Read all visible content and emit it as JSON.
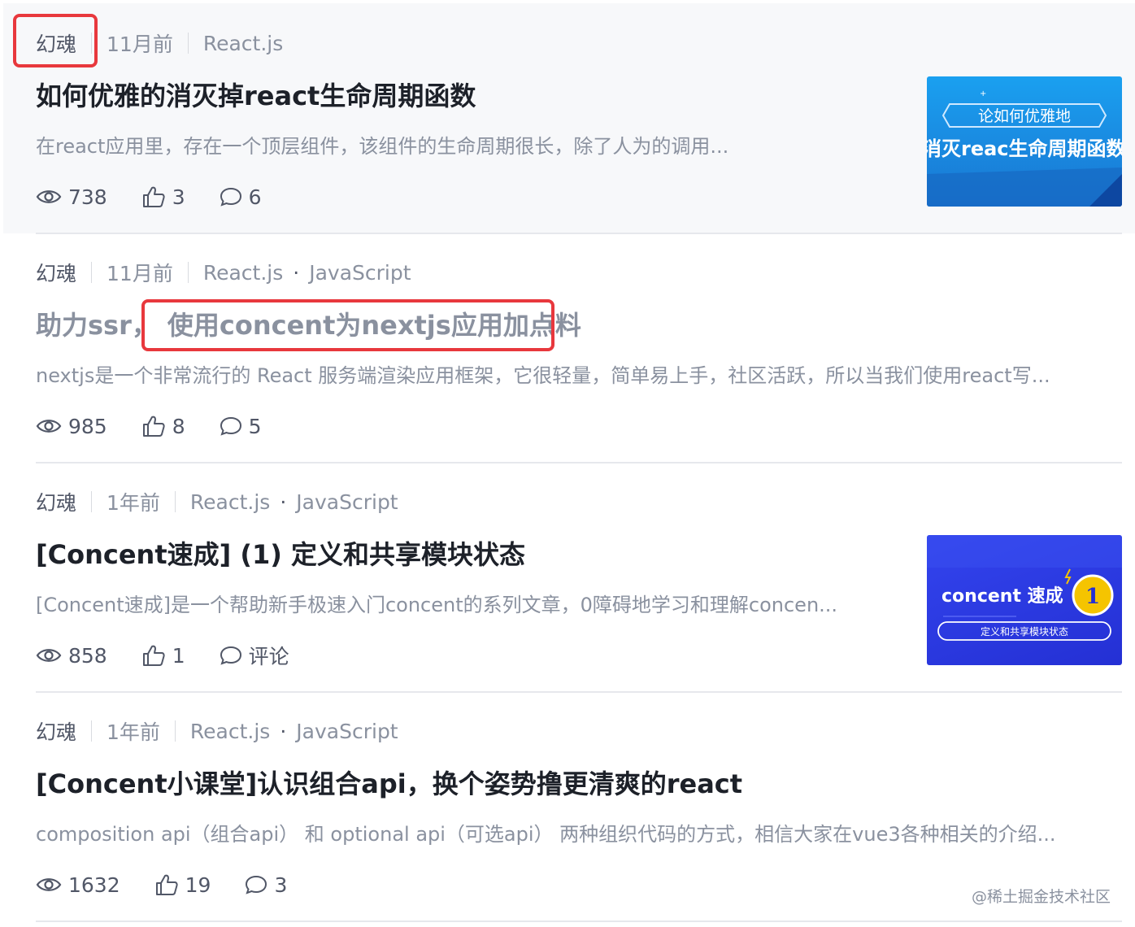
{
  "articles": [
    {
      "author": "幻魂",
      "time": "11月前",
      "tags": [
        "React.js"
      ],
      "title": "如何优雅的消灭掉react生命周期函数",
      "desc": "在react应用里，存在一个顶层组件，该组件的生命周期很长，除了人为的调用...",
      "views": "738",
      "likes": "3",
      "comments": "6",
      "thumb": {
        "line1": "论如何优雅地",
        "line2": "消灭reac生命周期函数"
      }
    },
    {
      "author": "幻魂",
      "time": "11月前",
      "tags": [
        "React.js",
        "JavaScript"
      ],
      "title_a": "助力ssr，",
      "title_b": "使用concent为nextjs应用加点料",
      "desc": "nextjs是一个非常流行的 React 服务端渲染应用框架，它很轻量，简单易上手，社区活跃，所以当我们使用react写...",
      "views": "985",
      "likes": "8",
      "comments": "5"
    },
    {
      "author": "幻魂",
      "time": "1年前",
      "tags": [
        "React.js",
        "JavaScript"
      ],
      "title": "[Concent速成] (1) 定义和共享模块状态",
      "desc": "[Concent速成]是一个帮助新手极速入门concent的系列文章，0障碍地学习和理解concen...",
      "views": "858",
      "likes": "1",
      "comments": "评论",
      "thumb": {
        "brand": "concent 速成",
        "badge": "1",
        "sub": "定义和共享模块状态"
      }
    },
    {
      "author": "幻魂",
      "time": "1年前",
      "tags": [
        "React.js",
        "JavaScript"
      ],
      "title": "[Concent小课堂]认识组合api，换个姿势撸更清爽的react",
      "desc": "composition api（组合api） 和 optional api（可选api） 两种组织代码的方式，相信大家在vue3各种相关的介绍...",
      "views": "1632",
      "likes": "19",
      "comments": "3"
    }
  ],
  "tag_separator": "·",
  "watermark": "@稀土掘金技术社区",
  "colors": {
    "highlight_border": "#e8383d",
    "title": "#1d2129",
    "muted": "#8a919f",
    "thumb1_bg": "#1e88e5",
    "thumb3_bg": "#2d3be0"
  },
  "icons": {
    "views": "eye-icon",
    "likes": "thumbs-up-icon",
    "comments": "comment-icon"
  }
}
